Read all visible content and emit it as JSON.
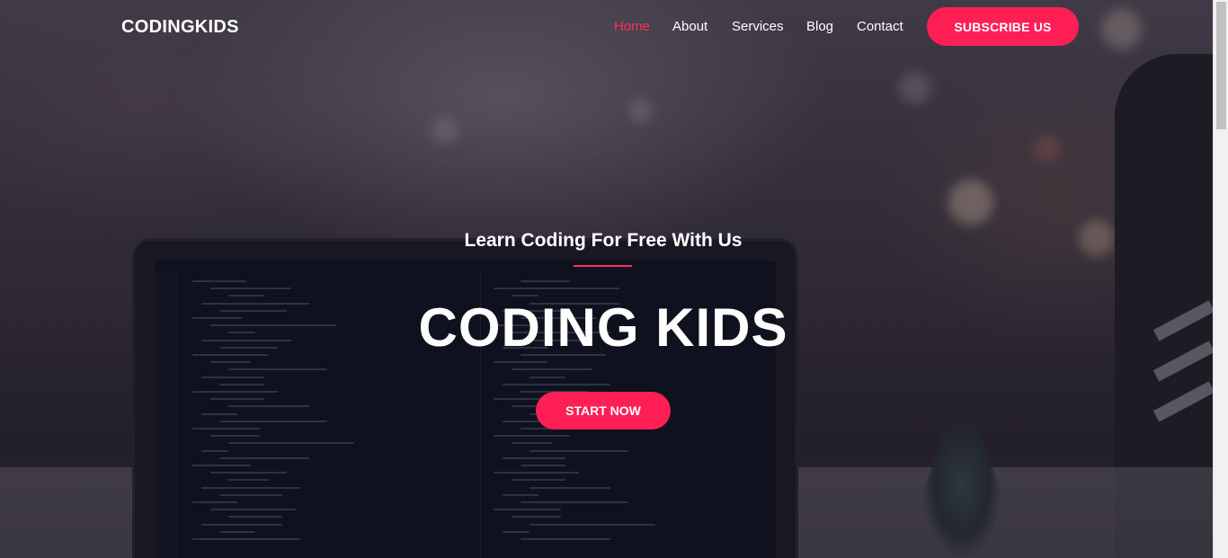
{
  "navbar": {
    "brand": "CODINGKIDS",
    "links": [
      {
        "label": "Home",
        "active": true
      },
      {
        "label": "About",
        "active": false
      },
      {
        "label": "Services",
        "active": false
      },
      {
        "label": "Blog",
        "active": false
      },
      {
        "label": "Contact",
        "active": false
      }
    ],
    "subscribe_label": "SUBSCRIBE US"
  },
  "hero": {
    "subtitle": "Learn Coding For Free With Us",
    "headline": "CODING KIDS",
    "cta_label": "START NOW",
    "background_image": "laptop-with-code-on-desk"
  },
  "colors": {
    "accent": "#ff1f55",
    "active_link": "#ff2d55",
    "text": "#ffffff"
  }
}
